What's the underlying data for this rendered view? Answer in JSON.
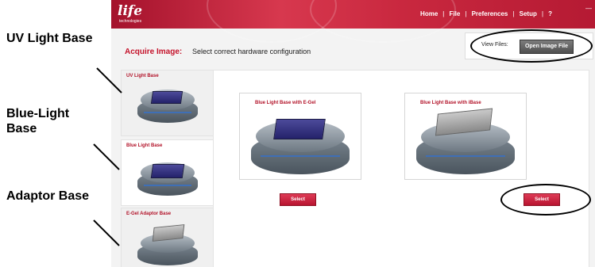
{
  "annotations": {
    "uv": "UV Light Base",
    "blue_line1": "Blue-Light",
    "blue_line2": "Base",
    "adaptor": "Adaptor Base"
  },
  "app": {
    "logo": "life",
    "logo_sub": "technologies",
    "menu": [
      "Home",
      "File",
      "Preferences",
      "Setup",
      "?"
    ],
    "acquire_title": "Acquire Image:",
    "acquire_subtitle": "Select correct hardware configuration",
    "view_files_label": "View Files:",
    "open_button": "Open Image File",
    "sidebar": [
      {
        "label": "UV Light Base"
      },
      {
        "label": "Blue Light Base"
      },
      {
        "label": "E-Gel Adaptor Base"
      }
    ],
    "cards": [
      {
        "label": "Blue Light Base with E-Gel",
        "button": "Select"
      },
      {
        "label": "Blue Light Base with iBase",
        "button": "Select"
      }
    ]
  },
  "colors": {
    "accent": "#c5142c",
    "topbar": "#c9283f"
  }
}
